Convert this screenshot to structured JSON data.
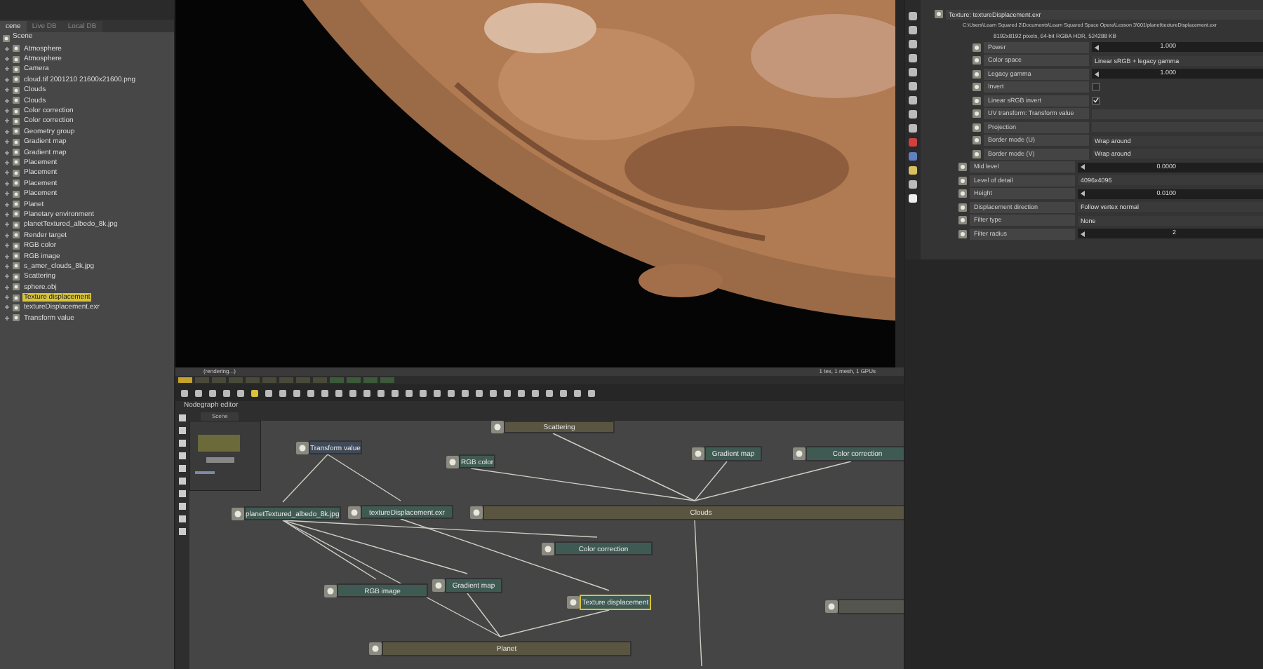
{
  "outliner": {
    "tabs": [
      {
        "label": "cene",
        "selected": true
      },
      {
        "label": "Live DB",
        "selected": false
      },
      {
        "label": "Local DB",
        "selected": false
      }
    ],
    "root": "Scene",
    "items": [
      {
        "label": "Atmosphere",
        "selected": false
      },
      {
        "label": "Atmosphere",
        "selected": false
      },
      {
        "label": "Camera",
        "selected": false
      },
      {
        "label": "cloud.tif 2001210 21600x21600.png",
        "selected": false
      },
      {
        "label": "Clouds",
        "selected": false
      },
      {
        "label": "Clouds",
        "selected": false
      },
      {
        "label": "Color correction",
        "selected": false
      },
      {
        "label": "Color correction",
        "selected": false
      },
      {
        "label": "Geometry group",
        "selected": false
      },
      {
        "label": "Gradient map",
        "selected": false
      },
      {
        "label": "Gradient map",
        "selected": false
      },
      {
        "label": "Placement",
        "selected": false
      },
      {
        "label": "Placement",
        "selected": false
      },
      {
        "label": "Placement",
        "selected": false
      },
      {
        "label": "Placement",
        "selected": false
      },
      {
        "label": "Planet",
        "selected": false
      },
      {
        "label": "Planetary environment",
        "selected": false
      },
      {
        "label": "planetTextured_albedo_8k.jpg",
        "selected": false
      },
      {
        "label": "Render target",
        "selected": false
      },
      {
        "label": "RGB color",
        "selected": false
      },
      {
        "label": "RGB image",
        "selected": false
      },
      {
        "label": "s_amer_clouds_8k.jpg",
        "selected": false
      },
      {
        "label": "Scattering",
        "selected": false
      },
      {
        "label": "sphere.obj",
        "selected": false
      },
      {
        "label": "Texture displacement",
        "selected": true
      },
      {
        "label": "textureDisplacement.exr",
        "selected": false
      },
      {
        "label": "Transform value",
        "selected": false
      }
    ]
  },
  "viewport": {
    "status_left": "(rendering...)",
    "status_right": "1 tex, 1 mesh, 1 GPUs"
  },
  "nodegraph": {
    "title": "Nodegraph editor",
    "tab": "Scene",
    "nodes": [
      {
        "label": "Scattering",
        "kind": "material",
        "selected": false
      },
      {
        "label": "Transform value",
        "kind": "value",
        "selected": false
      },
      {
        "label": "RGB color",
        "kind": "texture",
        "selected": false
      },
      {
        "label": "Gradient map",
        "kind": "texture",
        "selected": false
      },
      {
        "label": "Color correction",
        "kind": "texture",
        "selected": false
      },
      {
        "label": "planetTextured_albedo_8k.jpg",
        "kind": "texture",
        "selected": false
      },
      {
        "label": "textureDisplacement.exr",
        "kind": "texture",
        "selected": false
      },
      {
        "label": "Clouds",
        "kind": "material",
        "selected": false
      },
      {
        "label": "Color correction",
        "kind": "texture",
        "selected": false
      },
      {
        "label": "RGB image",
        "kind": "texture",
        "selected": false
      },
      {
        "label": "Gradient map",
        "kind": "texture",
        "selected": false
      },
      {
        "label": "Texture displacement",
        "kind": "texture",
        "selected": true
      },
      {
        "label": "Planet",
        "kind": "material",
        "selected": false
      }
    ]
  },
  "inspector": {
    "header": "Texture: textureDisplacement.exr",
    "path": "C:\\Users\\Learn Squared 2\\Documents\\Learn Squared Space Opera\\Lesson 3\\001\\planet\\textureDisplacement.exr",
    "info": "8192x8192 pixels, 64-bit RGBA HDR, 524288 KB",
    "texture_params": [
      {
        "label": "Power",
        "kind": "slider",
        "value": "1.000"
      },
      {
        "label": "Color space",
        "kind": "dropdown",
        "value": "Linear sRGB + legacy gamma"
      },
      {
        "label": "Legacy gamma",
        "kind": "slider",
        "value": "1.000"
      },
      {
        "label": "Invert",
        "kind": "checkbox",
        "checked": false
      },
      {
        "label": "Linear sRGB invert",
        "kind": "checkbox",
        "checked": true
      },
      {
        "label": "UV transform: Transform value",
        "kind": "link"
      },
      {
        "label": "Projection",
        "kind": "link"
      },
      {
        "label": "Border mode (U)",
        "kind": "dropdown",
        "value": "Wrap around"
      },
      {
        "label": "Border mode (V)",
        "kind": "dropdown",
        "value": "Wrap around"
      }
    ],
    "params": [
      {
        "label": "Mid level",
        "kind": "slider",
        "value": "0.0000"
      },
      {
        "label": "Level of detail",
        "kind": "dropdown",
        "value": "4096x4096"
      },
      {
        "label": "Height",
        "kind": "slider",
        "value": "0.0100"
      },
      {
        "label": "Displacement direction",
        "kind": "dropdown",
        "value": "Follow vertex normal"
      },
      {
        "label": "Filter type",
        "kind": "dropdown",
        "value": "None"
      },
      {
        "label": "Filter radius",
        "kind": "slider",
        "value": "2"
      }
    ]
  }
}
